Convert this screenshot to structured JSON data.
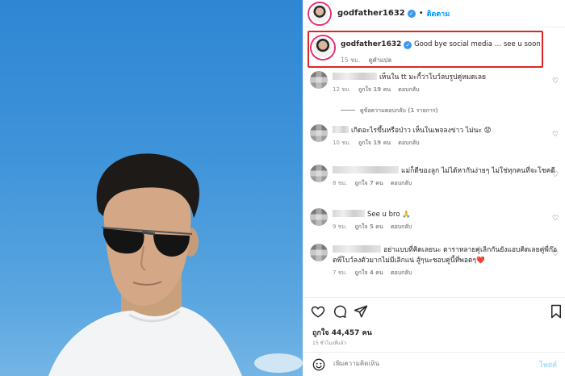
{
  "header": {
    "username": "godfather1632",
    "verified": "✓",
    "dot": "•",
    "follow_label": "ติดตาม"
  },
  "caption": {
    "username": "godfather1632",
    "text": "Good bye social media … see u soon",
    "time": "15 ชม.",
    "translate": "ดูคำแปล"
  },
  "comments": [
    {
      "text": "เห็นใน tt มะกี้ว่าโบว์ลบรูปคู่หมดเลย",
      "time": "12 ชม.",
      "likes": "ถูกใจ 19 คน",
      "reply": "ตอบกลับ",
      "view_replies": "ดูข้อความตอบกลับ (1 รายการ)"
    },
    {
      "text": "เกิดอะไรขึ้นหรือป่าว เห็นในเพจลงข่าว ไม่นะ 😟",
      "time": "10 ชม.",
      "likes": "ถูกใจ 19 คน",
      "reply": "ตอบกลับ"
    },
    {
      "text": "แม่ก็ดีของลูก ไม่ได้หากันง่ายๆ ไม่ใช่ทุกคนที่จะโชคดี",
      "time": "8 ชม.",
      "likes": "ถูกใจ 7 คน",
      "reply": "ตอบกลับ"
    },
    {
      "text": "See u bro 🙏",
      "time": "9 ชม.",
      "likes": "ถูกใจ 5 คน",
      "reply": "ตอบกลับ"
    },
    {
      "text": "อย่าแบบที่คิดเลยนะ ดาราหลายคู่เลิกกันยังแอบคิดเลยคู่พี่ก๊อตพี่โบว์ลงตัวมากไม่มีเลิกแน่ สู้ๆนะชอบคู่นี้ที่พอดๆ❤️",
      "time": "7 ชม.",
      "likes": "ถูกใจ 4 คน",
      "reply": "ตอบกลับ"
    }
  ],
  "footer": {
    "likes": "ถูกใจ 44,457 คน",
    "time": "15 ชั่วโมงที่แล้ว",
    "comment_placeholder": "เพิ่มความคิดเห็น",
    "post_label": "โพสต์"
  },
  "colors": {
    "accent": "#0095f6",
    "highlight_border": "#e02424",
    "muted": "#8e8e8e"
  },
  "icons": [
    "heart-icon",
    "comment-icon",
    "share-icon",
    "bookmark-icon",
    "emoji-icon"
  ]
}
